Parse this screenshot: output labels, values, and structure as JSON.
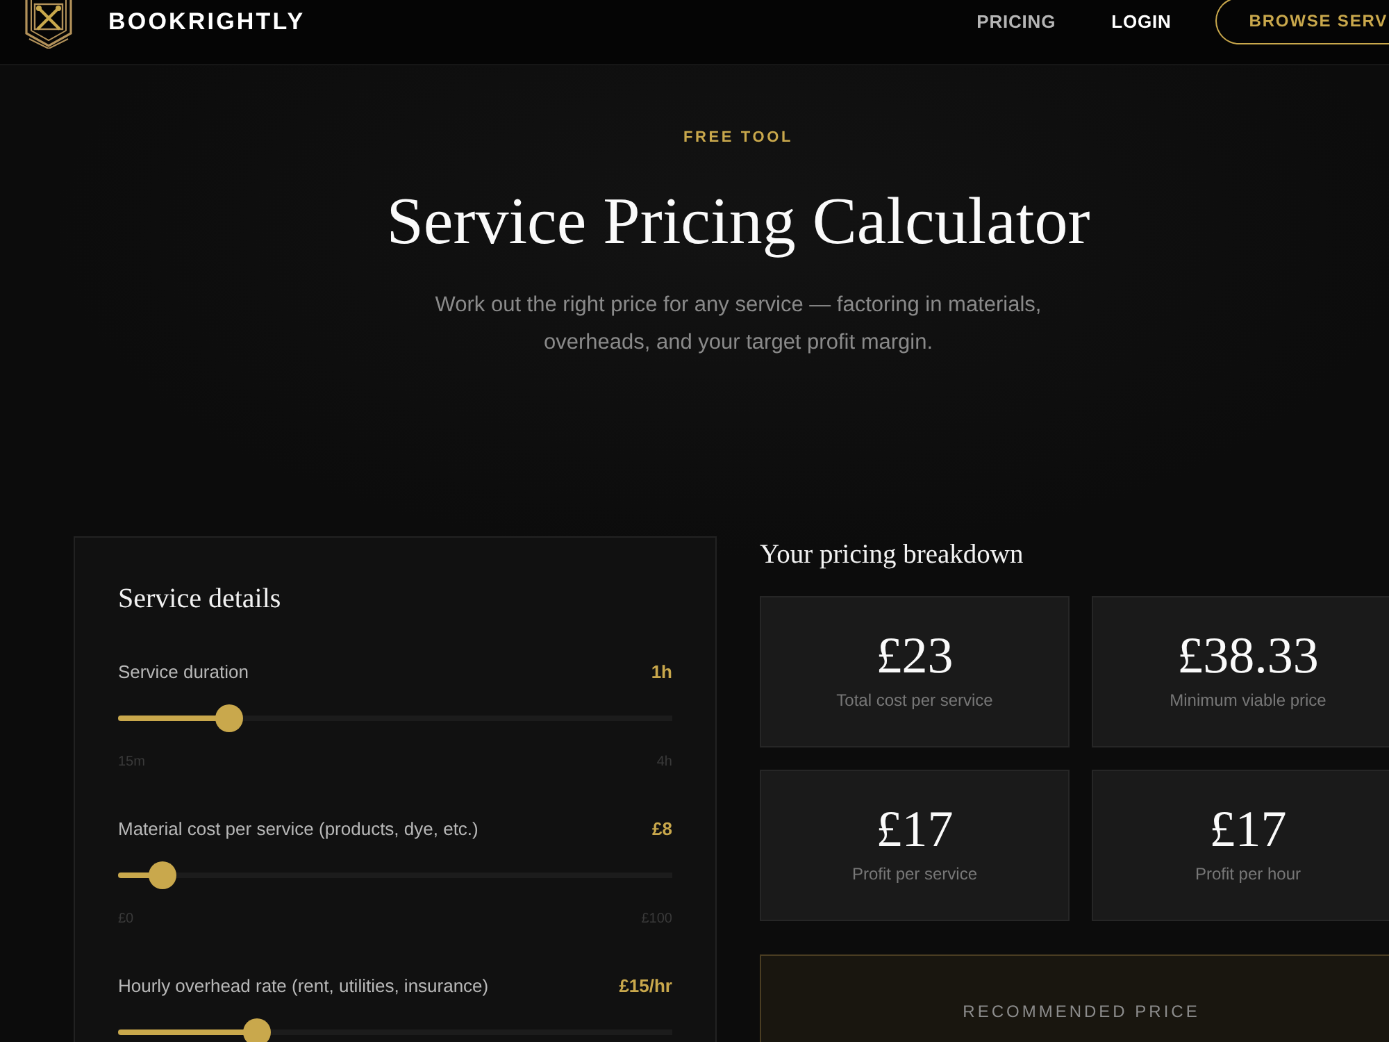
{
  "header": {
    "brand": "BOOKRIGHTLY",
    "nav": [
      {
        "label": "PRICING",
        "highlighted": false
      },
      {
        "label": "LOGIN",
        "highlighted": true
      }
    ],
    "cta": {
      "label": "BROWSE SERV"
    }
  },
  "hero": {
    "eyebrow": "FREE TOOL",
    "title": "Service Pricing Calculator",
    "subtitle": "Work out the right price for any service — factoring in materials, overheads, and your target profit margin."
  },
  "service_details": {
    "title": "Service details",
    "sliders": [
      {
        "label": "Service duration",
        "value": "1h",
        "level": 0.2,
        "min": "15m",
        "max": "4h"
      },
      {
        "label": "Material cost per service (products, dye, etc.)",
        "value": "£8",
        "level": 0.08,
        "min": "£0",
        "max": "£100"
      },
      {
        "label": "Hourly overhead rate (rent, utilities, insurance)",
        "value": "£15/hr",
        "level": 0.25
      }
    ]
  },
  "pricing_breakdown": {
    "title": "Your pricing breakdown",
    "metrics": [
      {
        "value": "£23",
        "label": "Total cost per service"
      },
      {
        "value": "£38.33",
        "label": "Minimum viable price"
      },
      {
        "value": "£17",
        "label": "Profit per service"
      },
      {
        "value": "£17",
        "label": "Profit per hour"
      }
    ],
    "recommended": {
      "label": "RECOMMENDED PRICE"
    }
  }
}
